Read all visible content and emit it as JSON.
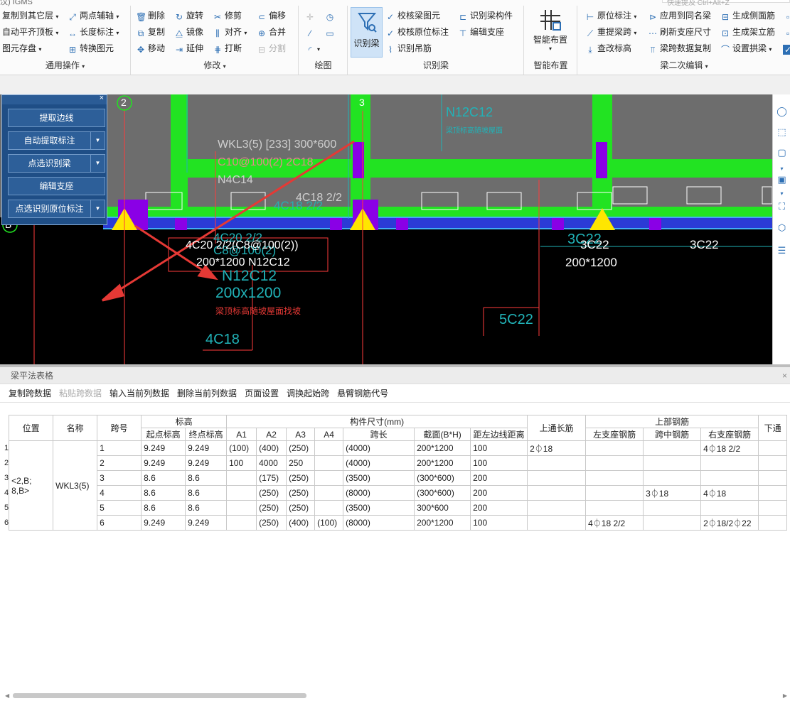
{
  "ribbon": {
    "top_text": "汉)     IGMS",
    "search_hint": "快速提及 Ctrl+Alt+Z",
    "groups": {
      "general": {
        "title": "通用操作",
        "items": [
          "复制到其它层",
          "自动平齐顶板",
          "图元存盘",
          "两点辅轴",
          "长度标注",
          "转换图元"
        ]
      },
      "modify": {
        "title": "修改",
        "items": [
          "删除",
          "复制",
          "移动",
          "旋转",
          "镜像",
          "延伸",
          "修剪",
          "对齐",
          "打断",
          "偏移",
          "合并",
          "分割"
        ]
      },
      "draw": {
        "title": "绘图"
      },
      "recognize": {
        "title": "识别梁",
        "big": "识别梁",
        "items": [
          "校核梁图元",
          "校核原位标注",
          "识别吊筋",
          "识别梁构件",
          "编辑支座"
        ]
      },
      "smart": {
        "title": "智能布置",
        "big": "智能布置"
      },
      "secondary": {
        "title": "梁二次编辑",
        "items": [
          "原位标注",
          "重提梁跨",
          "查改标高",
          "应用到同名梁",
          "刷新支座尺寸",
          "梁跨数据复制",
          "生成侧面筋",
          "生成架立筋",
          "设置拱梁"
        ]
      }
    }
  },
  "panel": {
    "close": "×",
    "buttons": [
      "提取边线",
      "自动提取标注",
      "点选识别梁",
      "编辑支座",
      "点选识别原位标注"
    ]
  },
  "cad": {
    "axis_labels": [
      "2",
      "3",
      "B"
    ],
    "beam_label": "WKL3(5) [233] 300*600",
    "beam_stirrup": "C10@100(2) 2C18",
    "beam_side": "N4C14",
    "rebar_4c18": "4C18 2/2",
    "rebar_4c18_ghost": "4C18 2/2",
    "anno_main_1": "4C20 2/2(C8@100(2))",
    "anno_main_2": "200*1200 N12C12",
    "anno_ghost_1": "4C20 2/2",
    "anno_ghost_2": "C8@100(2)",
    "anno_ghost_3": "N12C12",
    "anno_ghost_4": "200x1200",
    "anno_red": "梁顶标高随坡屋面找坡",
    "anno_4c18_low": "4C18",
    "anno_5c22": "5C22",
    "anno_3c22_ghost": "3C22",
    "anno_3c22_a": "3C22",
    "anno_3c22_b": "3C22",
    "anno_200x1200": "200*1200",
    "anno_top_ghost_1": "N12C12",
    "anno_top_ghost_2": "梁顶标高随坡屋面"
  },
  "table": {
    "window_title": "梁平法表格",
    "close": "×",
    "toolbar": [
      {
        "label": "复制跨数据",
        "enabled": true
      },
      {
        "label": "粘贴跨数据",
        "enabled": false
      },
      {
        "label": "输入当前列数据",
        "enabled": true
      },
      {
        "label": "删除当前列数据",
        "enabled": true
      },
      {
        "label": "页面设置",
        "enabled": true
      },
      {
        "label": "调换起始跨",
        "enabled": true
      },
      {
        "label": "悬臂钢筋代号",
        "enabled": true
      }
    ],
    "headers": {
      "position": "位置",
      "name": "名称",
      "span": "跨号",
      "elevation": "标高",
      "start_elev": "起点标高",
      "end_elev": "终点标高",
      "dims": "构件尺寸(mm)",
      "a1": "A1",
      "a2": "A2",
      "a3": "A3",
      "a4": "A4",
      "span_len": "跨长",
      "section": "截面(B*H)",
      "edge_dist": "距左边线距离",
      "top_through": "上通长筋",
      "top_rebar": "上部钢筋",
      "left_support": "左支座钢筋",
      "mid_span": "跨中钢筋",
      "right_support": "右支座钢筋",
      "bottom_through": "下通"
    },
    "position_value": "<2,B; 8,B>",
    "name_value": "WKL3(5)",
    "rows": [
      {
        "n": "1",
        "span": "1",
        "start": "9.249",
        "end": "9.249",
        "a1": "(100)",
        "a2": "(400)",
        "a3": "(250)",
        "a4": "",
        "len": "(4000)",
        "sec": "200*1200",
        "dist": "100",
        "top": "2⏀18",
        "left": "",
        "mid": "",
        "right": "4⏀18 2/2",
        "bot": ""
      },
      {
        "n": "2",
        "span": "2",
        "start": "9.249",
        "end": "9.249",
        "a1": "100",
        "a2": "4000",
        "a3": "250",
        "a4": "",
        "len": "(4000)",
        "sec": "200*1200",
        "dist": "100",
        "top": "",
        "left": "",
        "mid": "",
        "right": "",
        "bot": ""
      },
      {
        "n": "3",
        "span": "3",
        "start": "8.6",
        "end": "8.6",
        "a1": "",
        "a2": "(175)",
        "a3": "(250)",
        "a4": "",
        "len": "(3500)",
        "sec": "(300*600)",
        "dist": "200",
        "top": "",
        "left": "",
        "mid": "",
        "right": "",
        "bot": ""
      },
      {
        "n": "4",
        "span": "4",
        "start": "8.6",
        "end": "8.6",
        "a1": "",
        "a2": "(250)",
        "a3": "(250)",
        "a4": "",
        "len": "(8000)",
        "sec": "(300*600)",
        "dist": "200",
        "top": "",
        "left": "",
        "mid": "3⏀18",
        "right": "4⏀18",
        "bot": ""
      },
      {
        "n": "5",
        "span": "5",
        "start": "8.6",
        "end": "8.6",
        "a1": "",
        "a2": "(250)",
        "a3": "(250)",
        "a4": "",
        "len": "(3500)",
        "sec": "300*600",
        "dist": "200",
        "top": "",
        "left": "",
        "mid": "",
        "right": "",
        "bot": ""
      },
      {
        "n": "6",
        "span": "6",
        "start": "9.249",
        "end": "9.249",
        "a1": "",
        "a2": "(250)",
        "a3": "(400)",
        "a4": "(100)",
        "len": "(8000)",
        "sec": "200*1200",
        "dist": "100",
        "top": "",
        "left": "4⏀18 2/2",
        "mid": "",
        "right": "2⏀18/2⏀22",
        "bot": ""
      }
    ]
  },
  "colors": {
    "beam": "#22e322",
    "column": "#8a00e6",
    "support": "#ffe600",
    "axis": "#ff3b3b",
    "annotation_red": "#e53935",
    "cyan": "#21b3b8",
    "arrow": "#e53935"
  }
}
